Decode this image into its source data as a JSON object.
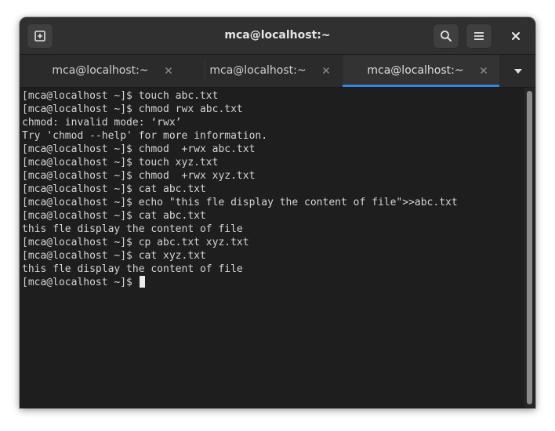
{
  "window": {
    "title": "mca@localhost:~"
  },
  "headerbar": {
    "new_tab_icon": "new-tab-icon",
    "search_icon": "search-icon",
    "menu_icon": "hamburger-menu-icon",
    "close_icon": "close-icon"
  },
  "tabs": [
    {
      "label": "mca@localhost:~",
      "active": false
    },
    {
      "label": "mca@localhost:~",
      "active": false
    },
    {
      "label": "mca@localhost:~",
      "active": true
    }
  ],
  "tab_dropdown_icon": "chevron-down-icon",
  "terminal": {
    "lines": [
      "[mca@localhost ~]$ touch abc.txt",
      "[mca@localhost ~]$ chmod rwx abc.txt",
      "chmod: invalid mode: ‘rwx’",
      "Try 'chmod --help' for more information.",
      "[mca@localhost ~]$ chmod  +rwx abc.txt",
      "[mca@localhost ~]$ touch xyz.txt",
      "[mca@localhost ~]$ chmod  +rwx xyz.txt",
      "[mca@localhost ~]$ cat abc.txt",
      "[mca@localhost ~]$ echo \"this fle display the content of file\">>abc.txt",
      "[mca@localhost ~]$ cat abc.txt",
      "this fle display the content of file",
      "[mca@localhost ~]$ cp abc.txt xyz.txt",
      "[mca@localhost ~]$ cat xyz.txt",
      "this fle display the content of file"
    ],
    "prompt": "[mca@localhost ~]$ "
  },
  "colors": {
    "accent": "#3584e4",
    "terminal_bg": "#1e1e1e",
    "terminal_fg": "#d4d4d4",
    "headerbar_bg": "#303030"
  }
}
